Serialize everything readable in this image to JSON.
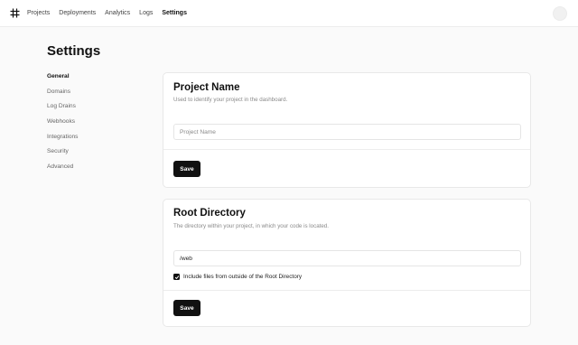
{
  "nav": {
    "items": [
      {
        "label": "Projects"
      },
      {
        "label": "Deployments"
      },
      {
        "label": "Analytics"
      },
      {
        "label": "Logs"
      },
      {
        "label": "Settings"
      }
    ],
    "active_index": 4,
    "logo_icon": "grid-hash-icon",
    "avatar_icon": "user-avatar"
  },
  "page": {
    "title": "Settings"
  },
  "sidebar": {
    "items": [
      {
        "label": "General"
      },
      {
        "label": "Domains"
      },
      {
        "label": "Log Drains"
      },
      {
        "label": "Webhooks"
      },
      {
        "label": "Integrations"
      },
      {
        "label": "Security"
      },
      {
        "label": "Advanced"
      }
    ],
    "active_index": 0
  },
  "project_name": {
    "title": "Project Name",
    "description": "Used to identify your project in the dashboard.",
    "input_value": "",
    "input_placeholder": "Project Name",
    "save_label": "Save"
  },
  "root_directory": {
    "title": "Root Directory",
    "description": "The directory within your project, in which your code is located.",
    "input_value": "/web",
    "checkbox_checked": true,
    "checkbox_label": "Include files from outside of the Root Directory",
    "save_label": "Save"
  },
  "colors": {
    "background": "#fafafa",
    "primary_button": "#111111",
    "text_muted": "#8a8a8a"
  }
}
